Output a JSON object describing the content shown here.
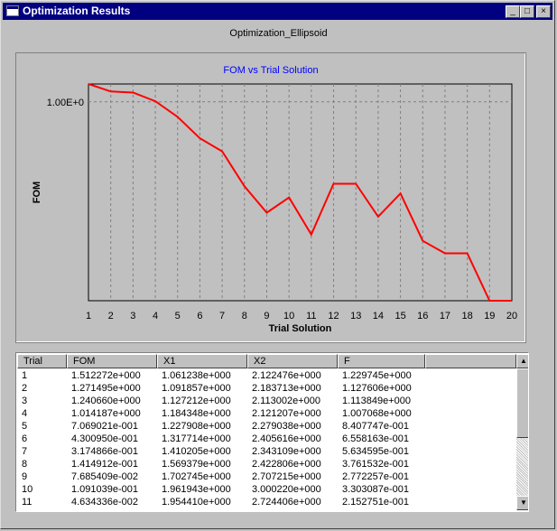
{
  "window": {
    "title": "Optimization Results",
    "minimize_label": "_",
    "maximize_label": "□",
    "close_label": "×"
  },
  "document_title": "Optimization_Ellipsoid",
  "chart_data": {
    "type": "line",
    "title": "FOM vs Trial Solution",
    "xlabel": "Trial Solution",
    "ylabel": "FOM",
    "x": [
      1,
      2,
      3,
      4,
      5,
      6,
      7,
      8,
      9,
      10,
      11,
      12,
      13,
      14,
      15,
      16,
      17,
      18,
      19,
      20
    ],
    "xlim": [
      1,
      20
    ],
    "y_tick_labels": [
      "1.00E+0"
    ],
    "series": [
      {
        "values": [
          1.512272,
          1.271495,
          1.24066,
          1.014187,
          0.7069021,
          0.430095,
          0.3174866,
          0.1414912,
          0.07685409,
          0.1091039,
          0.04634336,
          0.15,
          0.15,
          0.07,
          0.12,
          0.04,
          0.03,
          0.03,
          0.01,
          0.01
        ],
        "color": "#ff0000"
      }
    ],
    "grid": true,
    "log_scale_y": true,
    "title_color": "#0000ff"
  },
  "table": {
    "columns": [
      "Trial",
      "FOM",
      "X1",
      "X2",
      "F"
    ],
    "rows": [
      [
        "1",
        "1.512272e+000",
        "1.061238e+000",
        "2.122476e+000",
        "1.229745e+000"
      ],
      [
        "2",
        "1.271495e+000",
        "1.091857e+000",
        "2.183713e+000",
        "1.127606e+000"
      ],
      [
        "3",
        "1.240660e+000",
        "1.127212e+000",
        "2.113002e+000",
        "1.113849e+000"
      ],
      [
        "4",
        "1.014187e+000",
        "1.184348e+000",
        "2.121207e+000",
        "1.007068e+000"
      ],
      [
        "5",
        "7.069021e-001",
        "1.227908e+000",
        "2.279038e+000",
        "8.407747e-001"
      ],
      [
        "6",
        "4.300950e-001",
        "1.317714e+000",
        "2.405616e+000",
        "6.558163e-001"
      ],
      [
        "7",
        "3.174866e-001",
        "1.410205e+000",
        "2.343109e+000",
        "5.634595e-001"
      ],
      [
        "8",
        "1.414912e-001",
        "1.569379e+000",
        "2.422806e+000",
        "3.761532e-001"
      ],
      [
        "9",
        "7.685409e-002",
        "1.702745e+000",
        "2.707215e+000",
        "2.772257e-001"
      ],
      [
        "10",
        "1.091039e-001",
        "1.961943e+000",
        "3.000220e+000",
        "3.303087e-001"
      ],
      [
        "11",
        "4.634336e-002",
        "1.954410e+000",
        "2.724406e+000",
        "2.152751e-001"
      ]
    ],
    "scroll_up_label": "▲",
    "scroll_down_label": "▼"
  }
}
